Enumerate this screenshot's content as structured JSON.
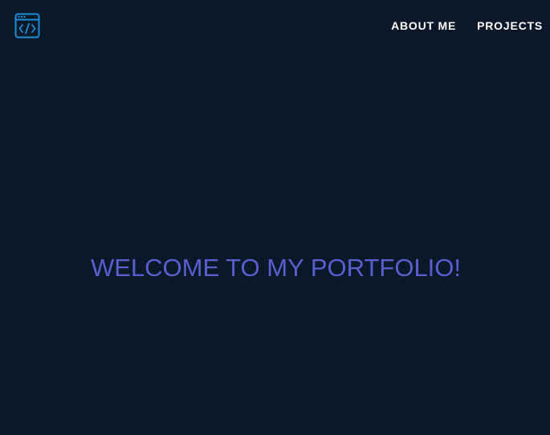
{
  "theme": {
    "background": "#0a1829",
    "accent_icon": "#1a8fd6",
    "hero_text_color": "#5a5fcf",
    "nav_text_color": "#ffffff"
  },
  "header": {
    "logo_icon": "code-window-icon",
    "nav": [
      {
        "label": "ABOUT ME"
      },
      {
        "label": "PROJECTS"
      }
    ]
  },
  "hero": {
    "title": "WELCOME TO MY PORTFOLIO!"
  }
}
